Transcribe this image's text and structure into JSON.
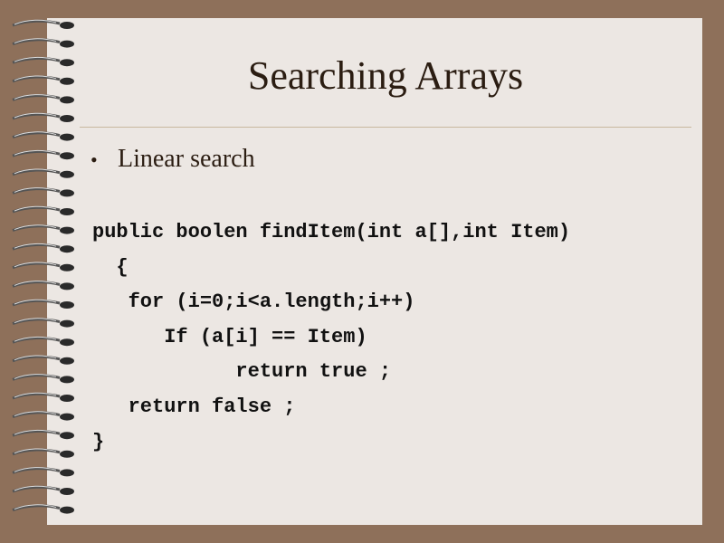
{
  "slide": {
    "title": "Searching Arrays",
    "bullet": "Linear search",
    "code_lines": [
      "public boolen findItem(int a[],int Item)",
      "  {",
      "   for (i=0;i<a.length;i++)",
      "      If (a[i] == Item)",
      "            return true ;",
      "   return false ;",
      "}"
    ]
  },
  "colors": {
    "background": "#8e705a",
    "page": "#ece7e3",
    "title_text": "#2b1d12",
    "rule": "#c9b89f"
  },
  "icons": [
    "spiral-binding-icon",
    "bullet-icon"
  ]
}
